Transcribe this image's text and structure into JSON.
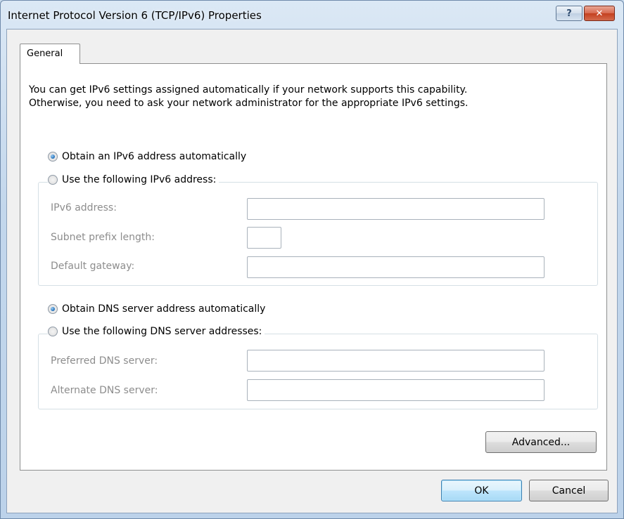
{
  "window": {
    "title": "Internet Protocol Version 6 (TCP/IPv6) Properties",
    "help_glyph": "?",
    "close_glyph": "✕"
  },
  "tabs": [
    {
      "label": "General",
      "selected": true
    }
  ],
  "general": {
    "intro_line1": "You can get IPv6 settings assigned automatically if your network supports this capability.",
    "intro_line2": "Otherwise, you need to ask your network administrator for the appropriate IPv6 settings.",
    "address": {
      "auto_label": "Obtain an IPv6 address automatically",
      "auto_selected": true,
      "manual_label": "Use the following IPv6 address:",
      "manual_selected": false,
      "ipv6_address_label": "IPv6 address:",
      "ipv6_address_value": "",
      "subnet_prefix_label": "Subnet prefix length:",
      "subnet_prefix_value": "",
      "gateway_label": "Default gateway:",
      "gateway_value": ""
    },
    "dns": {
      "auto_label": "Obtain DNS server address automatically",
      "auto_selected": true,
      "manual_label": "Use the following DNS server addresses:",
      "manual_selected": false,
      "preferred_label": "Preferred DNS server:",
      "preferred_value": "",
      "alternate_label": "Alternate DNS server:",
      "alternate_value": ""
    },
    "advanced_label": "Advanced..."
  },
  "footer": {
    "ok_label": "OK",
    "cancel_label": "Cancel"
  },
  "colors": {
    "disabled_text": "#8d8d8d",
    "group_border": "#d5dfe5",
    "default_button_border": "#3c7fb1"
  }
}
